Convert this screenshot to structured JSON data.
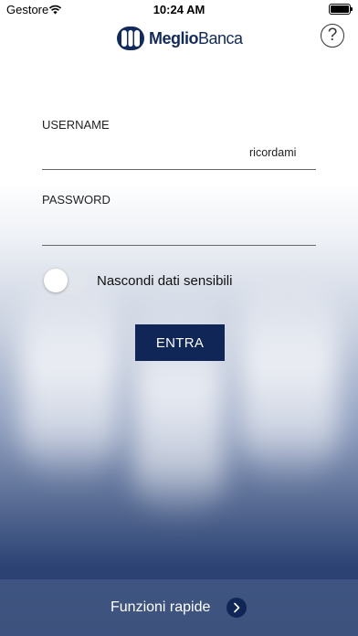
{
  "status_bar": {
    "carrier": "Gestore",
    "time": "10:24 AM"
  },
  "header": {
    "logo_part1": "Meglio",
    "logo_part2": "Banca",
    "help_label": "?"
  },
  "form": {
    "username_label": "USERNAME",
    "username_value": "",
    "remember_label": "ricordami",
    "password_label": "PASSWORD",
    "password_value": "",
    "hide_data_label": "Nascondi dati sensibili",
    "hide_data_enabled": false,
    "submit_label": "ENTRA"
  },
  "footer": {
    "quick_functions_label": "Funzioni rapide"
  },
  "colors": {
    "brand_dark": "#0f2657",
    "logo_text": "#132a5c"
  },
  "icons": {
    "wifi": "wifi-icon",
    "battery": "battery-icon",
    "help": "help-icon",
    "chevron": "chevron-right-icon"
  }
}
